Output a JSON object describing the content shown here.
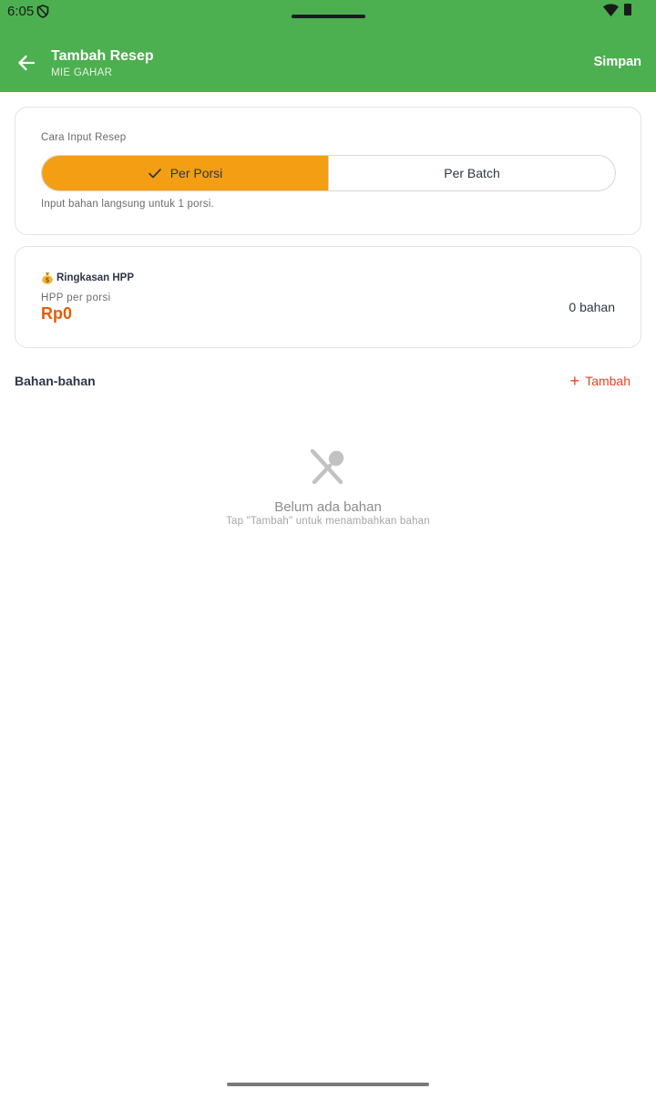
{
  "status_bar": {
    "time": "6:05"
  },
  "app_bar": {
    "title": "Tambah Resep",
    "subtitle": "MIE GAHAR",
    "save_label": "Simpan"
  },
  "input_mode": {
    "label": "Cara Input Resep",
    "options": [
      {
        "label": "Per Porsi",
        "selected": true
      },
      {
        "label": "Per Batch",
        "selected": false
      }
    ],
    "hint": "Input bahan langsung untuk 1 porsi."
  },
  "summary": {
    "icon": "moneybag-icon",
    "title": "Ringkasan HPP",
    "hpp_label": "HPP per porsi",
    "hpp_value": "Rp0",
    "ingredient_count": "0 bahan"
  },
  "ingredients": {
    "section_title": "Bahan-bahan",
    "add_label": "Tambah",
    "empty_title": "Belum ada bahan",
    "empty_hint": "Tap \"Tambah\" untuk menambahkan bahan"
  },
  "colors": {
    "app_bar": "#4caf50",
    "selected_option": "#f49e14",
    "hpp_value": "#e65c00",
    "add_action": "#ef4123"
  }
}
